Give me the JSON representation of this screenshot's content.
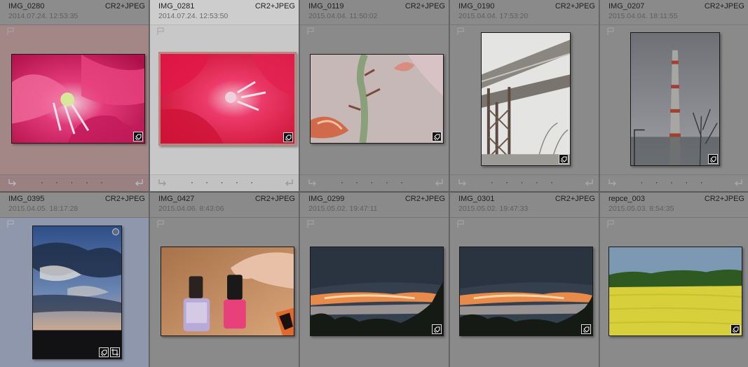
{
  "grid": {
    "cells": [
      {
        "name": "IMG_0280",
        "format": "CR2+JPEG",
        "date": "2014.07.24. 12:53:35",
        "state": "tinted-red"
      },
      {
        "name": "IMG_0281",
        "format": "CR2+JPEG",
        "date": "2014.07.24. 12:53:50",
        "state": "selected"
      },
      {
        "name": "IMG_0119",
        "format": "CR2+JPEG",
        "date": "2015.04.04. 11:50:02",
        "state": "normal"
      },
      {
        "name": "IMG_0190",
        "format": "CR2+JPEG",
        "date": "2015.04.04. 17:53:20",
        "state": "normal"
      },
      {
        "name": "IMG_0207",
        "format": "CR2+JPEG",
        "date": "2015.04.04. 18:11:55",
        "state": "normal"
      },
      {
        "name": "IMG_0395",
        "format": "CR2+JPEG",
        "date": "2015.04.05. 18:17:28",
        "state": "tinted-blue"
      },
      {
        "name": "IMG_0427",
        "format": "CR2+JPEG",
        "date": "2015.04.06. 8:43:06",
        "state": "normal"
      },
      {
        "name": "IMG_0299",
        "format": "CR2+JPEG",
        "date": "2015.05.02. 19:47:11",
        "state": "normal"
      },
      {
        "name": "IMG_0301",
        "format": "CR2+JPEG",
        "date": "2015.05.02. 19:47:33",
        "state": "normal"
      },
      {
        "name": "repce_003",
        "format": "CR2+JPEG",
        "date": "2015.05.03. 8:54:35",
        "state": "normal"
      }
    ],
    "rating_dots": "· · · · ·"
  },
  "colors": {
    "cell_bg": "#8a8a8a",
    "cell_selected": "#c6c6c6",
    "cell_tint_red": "#a88a8a",
    "cell_tint_blue": "#8f97ad",
    "thumb_border_selected": "#e8d0c8"
  },
  "icons": {
    "flag": "flag-icon",
    "rotate_left": "rotate-left-icon",
    "rotate_right": "rotate-right-icon",
    "keyword_badge": "keyword-tag-icon",
    "crop_badge": "crop-badge-icon"
  }
}
